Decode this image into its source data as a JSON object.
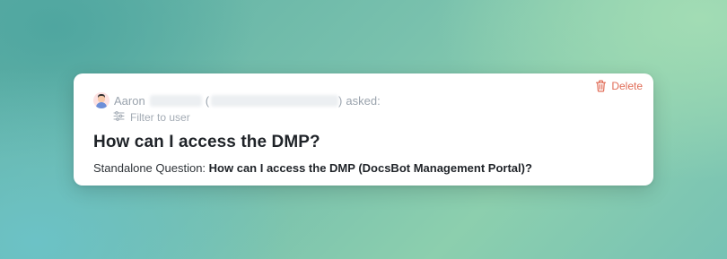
{
  "card": {
    "delete_label": "Delete",
    "asker": {
      "name_visible": "Aaron",
      "paren_open": "(",
      "paren_close": ")",
      "asked_label": "asked:"
    },
    "filter_label": "Filter to user",
    "question": "How can I access the DMP?",
    "standalone": {
      "label": "Standalone Question:",
      "text": "How can I access the DMP (DocsBot Management Portal)?"
    }
  },
  "colors": {
    "delete": "#e06c57",
    "muted_text": "#9aa3ad",
    "heading": "#1f2328",
    "card_bg": "#ffffff"
  },
  "icons": {
    "delete": "trash-icon",
    "filter": "sliders-icon",
    "avatar": "user-avatar"
  }
}
